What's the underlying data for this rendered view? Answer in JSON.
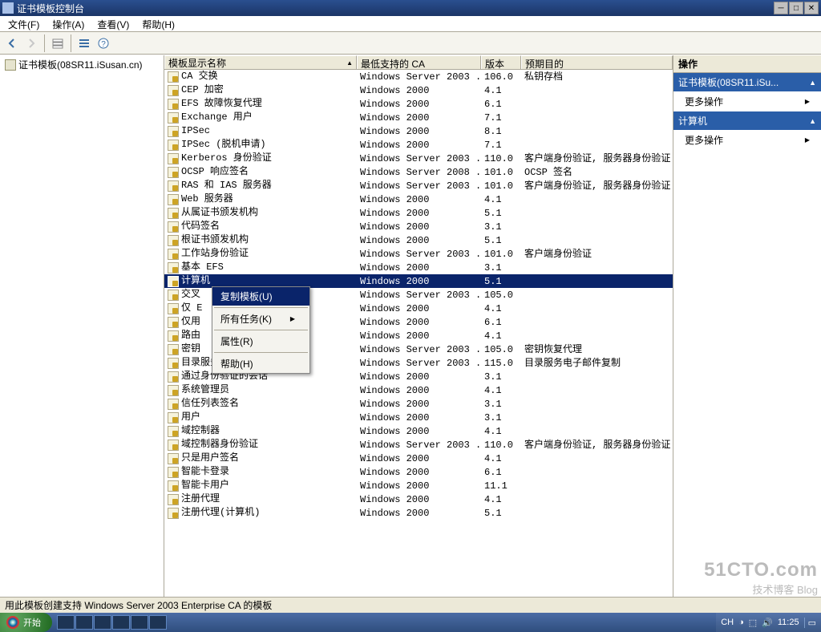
{
  "window": {
    "title": "证书模板控制台"
  },
  "menu": {
    "file": "文件(F)",
    "action": "操作(A)",
    "view": "查看(V)",
    "help": "帮助(H)"
  },
  "tree": {
    "root": "证书模板(08SR11.iSusan.cn)"
  },
  "columns": {
    "name": "模板显示名称",
    "ca": "最低支持的 CA",
    "ver": "版本",
    "purpose": "预期目的"
  },
  "rows": [
    {
      "name": "CA 交换",
      "ca": "Windows Server 2003 ...",
      "ver": "106.0",
      "purpose": "私钥存档"
    },
    {
      "name": "CEP 加密",
      "ca": "Windows 2000",
      "ver": "4.1",
      "purpose": ""
    },
    {
      "name": "EFS 故障恢复代理",
      "ca": "Windows 2000",
      "ver": "6.1",
      "purpose": ""
    },
    {
      "name": "Exchange 用户",
      "ca": "Windows 2000",
      "ver": "7.1",
      "purpose": ""
    },
    {
      "name": "IPSec",
      "ca": "Windows 2000",
      "ver": "8.1",
      "purpose": ""
    },
    {
      "name": "IPSec (脱机申请)",
      "ca": "Windows 2000",
      "ver": "7.1",
      "purpose": ""
    },
    {
      "name": "Kerberos 身份验证",
      "ca": "Windows Server 2003 ...",
      "ver": "110.0",
      "purpose": "客户端身份验证, 服务器身份验证"
    },
    {
      "name": "OCSP 响应签名",
      "ca": "Windows Server 2008 ...",
      "ver": "101.0",
      "purpose": "OCSP 签名"
    },
    {
      "name": "RAS 和 IAS 服务器",
      "ca": "Windows Server 2003 ...",
      "ver": "101.0",
      "purpose": "客户端身份验证, 服务器身份验证"
    },
    {
      "name": "Web 服务器",
      "ca": "Windows 2000",
      "ver": "4.1",
      "purpose": ""
    },
    {
      "name": "从属证书颁发机构",
      "ca": "Windows 2000",
      "ver": "5.1",
      "purpose": ""
    },
    {
      "name": "代码签名",
      "ca": "Windows 2000",
      "ver": "3.1",
      "purpose": ""
    },
    {
      "name": "根证书颁发机构",
      "ca": "Windows 2000",
      "ver": "5.1",
      "purpose": ""
    },
    {
      "name": "工作站身份验证",
      "ca": "Windows Server 2003 ...",
      "ver": "101.0",
      "purpose": "客户端身份验证"
    },
    {
      "name": "基本 EFS",
      "ca": "Windows 2000",
      "ver": "3.1",
      "purpose": ""
    },
    {
      "name": "计算机",
      "ca": "Windows 2000",
      "ver": "5.1",
      "purpose": "",
      "selected": true
    },
    {
      "name": "交叉",
      "ca": "Windows Server 2003 ...",
      "ver": "105.0",
      "purpose": ""
    },
    {
      "name": "仅 E",
      "ca": "Windows 2000",
      "ver": "4.1",
      "purpose": ""
    },
    {
      "name": "仅用",
      "ca": "Windows 2000",
      "ver": "6.1",
      "purpose": ""
    },
    {
      "name": "路由",
      "ca": "Windows 2000",
      "ver": "4.1",
      "purpose": ""
    },
    {
      "name": "密钥",
      "ca": "Windows Server 2003 ...",
      "ver": "105.0",
      "purpose": "密钥恢复代理"
    },
    {
      "name": "目录服务电子邮件复制",
      "ca": "Windows Server 2003 ...",
      "ver": "115.0",
      "purpose": "目录服务电子邮件复制"
    },
    {
      "name": "通过身份验证的会话",
      "ca": "Windows 2000",
      "ver": "3.1",
      "purpose": ""
    },
    {
      "name": "系统管理员",
      "ca": "Windows 2000",
      "ver": "4.1",
      "purpose": ""
    },
    {
      "name": "信任列表签名",
      "ca": "Windows 2000",
      "ver": "3.1",
      "purpose": ""
    },
    {
      "name": "用户",
      "ca": "Windows 2000",
      "ver": "3.1",
      "purpose": ""
    },
    {
      "name": "域控制器",
      "ca": "Windows 2000",
      "ver": "4.1",
      "purpose": ""
    },
    {
      "name": "域控制器身份验证",
      "ca": "Windows Server 2003 ...",
      "ver": "110.0",
      "purpose": "客户端身份验证, 服务器身份验证"
    },
    {
      "name": "只是用户签名",
      "ca": "Windows 2000",
      "ver": "4.1",
      "purpose": ""
    },
    {
      "name": "智能卡登录",
      "ca": "Windows 2000",
      "ver": "6.1",
      "purpose": ""
    },
    {
      "name": "智能卡用户",
      "ca": "Windows 2000",
      "ver": "11.1",
      "purpose": ""
    },
    {
      "name": "注册代理",
      "ca": "Windows 2000",
      "ver": "4.1",
      "purpose": ""
    },
    {
      "name": "注册代理(计算机)",
      "ca": "Windows 2000",
      "ver": "5.1",
      "purpose": ""
    }
  ],
  "context_menu": {
    "items": [
      {
        "label": "复制模板(U)",
        "selected": true
      },
      {
        "label": "所有任务(K)",
        "submenu": true
      },
      {
        "label": "属性(R)"
      },
      {
        "label": "帮助(H)"
      }
    ]
  },
  "actions": {
    "header": "操作",
    "group1": {
      "title": "证书模板(08SR11.iSu...",
      "more": "更多操作"
    },
    "group2": {
      "title": "计算机",
      "more": "更多操作"
    }
  },
  "status": "用此模板创建支持 Windows Server 2003 Enterprise CA 的模板",
  "taskbar": {
    "start": "开始",
    "lang": "CH",
    "time": "11:25"
  },
  "watermark": {
    "big": "51CTO.com",
    "small": "技术博客  Blog"
  }
}
